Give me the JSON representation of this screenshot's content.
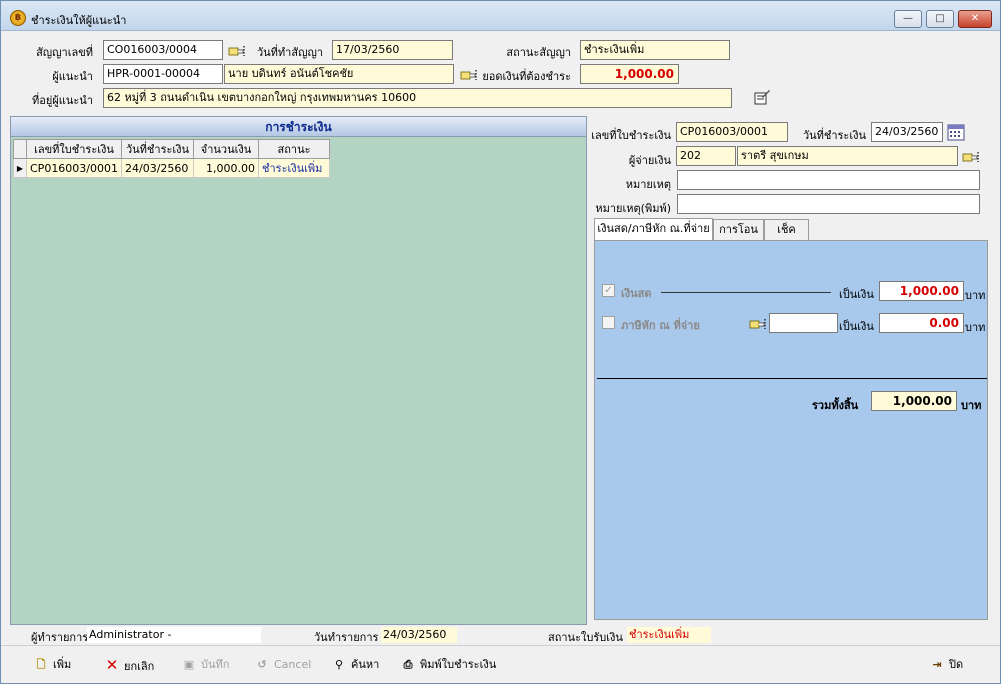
{
  "window": {
    "title": "ชำระเงินให้ผู้แนะนำ",
    "minimize": "—",
    "maximize": "□",
    "close": "✕"
  },
  "header": {
    "contract_no_label": "สัญญาเลขที่",
    "contract_no": "CO016003/0004",
    "contract_date_label": "วันที่ทำสัญญา",
    "contract_date": "17/03/2560",
    "contract_status_label": "สถานะสัญญา",
    "contract_status": "ชำระเงินเพิ่ม",
    "referrer_label": "ผู้แนะนำ",
    "referrer_code": "HPR-0001-00004",
    "referrer_name": "นาย บดินทร์ อนันต์โชคชัย",
    "amount_due_label": "ยอดเงินที่ต้องชำระ",
    "amount_due": "1,000.00",
    "address_label": "ที่อยู่ผู้แนะนำ",
    "address": "62 หมู่ที่ 3 ถนนดำเนิน เขตบางกอกใหญ่ กรุงเทพมหานคร 10600"
  },
  "payments_panel": {
    "title": "การชำระเงิน",
    "columns": [
      "เลขที่ใบชำระเงิน",
      "วันที่ชำระเงิน",
      "จำนวนเงิน",
      "สถานะ"
    ],
    "rows": [
      {
        "receipt_no": "CP016003/0001",
        "date": "24/03/2560",
        "amount": "1,000.00",
        "status": "ชำระเงินเพิ่ม"
      }
    ]
  },
  "detail": {
    "receipt_no_label": "เลขที่ใบชำระเงิน",
    "receipt_no": "CP016003/0001",
    "pay_date_label": "วันที่ชำระเงิน",
    "pay_date": "24/03/2560",
    "payer_label": "ผู้จ่ายเงิน",
    "payer_code": "202",
    "payer_name": "ราตรี สุขเกษม",
    "note_label": "หมายเหตุ",
    "note": "",
    "print_note_label": "หมายเหตุ(พิมพ์)",
    "print_note": ""
  },
  "tabs": [
    "เงินสด/ภาษีหัก ณ.ที่จ่าย",
    "การโอน",
    "เช็ค"
  ],
  "cash_tab": {
    "cash_label": "เงินสด",
    "cash_checked": true,
    "as_money_label": "เป็นเงิน",
    "cash_amount": "1,000.00",
    "baht": "บาท",
    "wht_label": "ภาษีหัก ณ ที่จ่าย",
    "wht_checked": false,
    "wht_ref": "",
    "wht_amount": "0.00",
    "total_label": "รวมทั้งสิ้น",
    "total_amount": "1,000.00"
  },
  "status_bar": {
    "operator_label": "ผู้ทำรายการ",
    "operator": "Administrator -",
    "txn_date_label": "วันทำรายการ",
    "txn_date": "24/03/2560",
    "receipt_status_label": "สถานะใบรับเงิน",
    "receipt_status": "ชำระเงินเพิ่ม"
  },
  "toolbar": {
    "add": "เพิ่ม",
    "cancel_doc": "ยกเลิก",
    "save": "บันทึก",
    "cancel": "Cancel",
    "search": "ค้นหา",
    "print": "พิมพ์ใบชำระเงิน",
    "close": "ปิด"
  },
  "colors": {
    "accent_red": "#d40000",
    "panel_green": "#b3d4c2",
    "panel_blue": "#a8c8ec",
    "field_yellow": "#fffbd9"
  }
}
